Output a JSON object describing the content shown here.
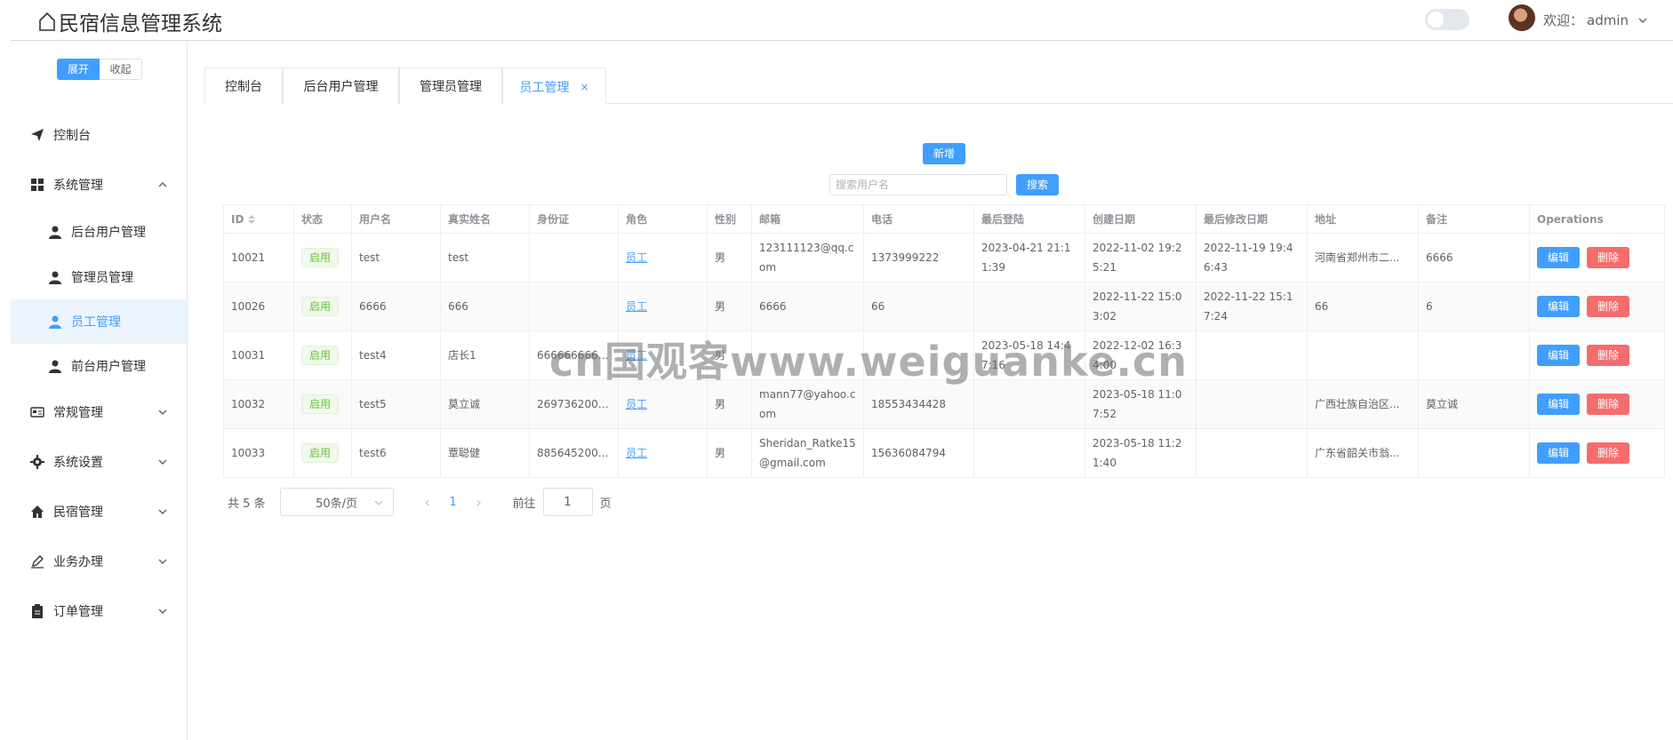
{
  "header": {
    "title": "民宿信息管理系统",
    "welcome_prefix": "欢迎：",
    "username": "admin"
  },
  "sidebar": {
    "expand_label": "展开",
    "collapse_label": "收起",
    "items": [
      {
        "label": "控制台",
        "icon": "paper-plane-icon"
      },
      {
        "label": "系统管理",
        "icon": "grid-icon",
        "expanded": true
      },
      {
        "label": "后台用户管理",
        "icon": "user-icon"
      },
      {
        "label": "管理员管理",
        "icon": "user-icon"
      },
      {
        "label": "员工管理",
        "icon": "user-icon",
        "active": true
      },
      {
        "label": "前台用户管理",
        "icon": "user-icon"
      },
      {
        "label": "常规管理",
        "icon": "id-card-icon"
      },
      {
        "label": "系统设置",
        "icon": "gear-icon"
      },
      {
        "label": "民宿管理",
        "icon": "house-icon"
      },
      {
        "label": "业务办理",
        "icon": "edit-pen-icon"
      },
      {
        "label": "订单管理",
        "icon": "clipboard-icon"
      }
    ]
  },
  "tabs": [
    {
      "label": "控制台"
    },
    {
      "label": "后台用户管理"
    },
    {
      "label": "管理员管理"
    },
    {
      "label": "员工管理",
      "active": true,
      "close": "×"
    }
  ],
  "toolbar": {
    "add_label": "新增",
    "search_placeholder": "搜索用户名",
    "search_label": "搜索"
  },
  "table": {
    "columns": [
      "ID",
      "状态",
      "用户名",
      "真实姓名",
      "身份证",
      "角色",
      "性别",
      "邮箱",
      "电话",
      "最后登陆",
      "创建日期",
      "最后修改日期",
      "地址",
      "备注",
      "Operations"
    ],
    "rows": [
      {
        "id": "10021",
        "status": "启用",
        "username": "test",
        "realname": "test",
        "idcard": "",
        "role": "员工",
        "gender": "男",
        "email": "123111123@qq.com",
        "phone": "1373999222",
        "last_login": "2023-04-21 21:11:39",
        "created": "2022-11-02 19:25:21",
        "modified": "2022-11-19 19:46:43",
        "address": "河南省郑州市二...",
        "remark": "6666"
      },
      {
        "id": "10026",
        "status": "启用",
        "username": "6666",
        "realname": "666",
        "idcard": "",
        "role": "员工",
        "gender": "男",
        "email": "6666",
        "phone": "66",
        "last_login": "",
        "created": "2022-11-22 15:03:02",
        "modified": "2022-11-22 15:17:24",
        "address": "66",
        "remark": "6"
      },
      {
        "id": "10031",
        "status": "启用",
        "username": "test4",
        "realname": "店长1",
        "idcard": "6666666666...",
        "role": "员工",
        "gender": "男",
        "email": "",
        "phone": "",
        "last_login": "2023-05-18 14:47:16",
        "created": "2022-12-02 16:34:00",
        "modified": "",
        "address": "",
        "remark": ""
      },
      {
        "id": "10032",
        "status": "启用",
        "username": "test5",
        "realname": "莫立诚",
        "idcard": "2697362001...",
        "role": "员工",
        "gender": "男",
        "email": "mann77@yahoo.com",
        "phone": "18553434428",
        "last_login": "",
        "created": "2023-05-18 11:07:52",
        "modified": "",
        "address": "广西壮族自治区...",
        "remark": "莫立诚"
      },
      {
        "id": "10033",
        "status": "启用",
        "username": "test6",
        "realname": "覃聪健",
        "idcard": "8856452009...",
        "role": "员工",
        "gender": "男",
        "email": "Sheridan_Ratke15@gmail.com",
        "phone": "15636084794",
        "last_login": "",
        "created": "2023-05-18 11:21:40",
        "modified": "",
        "address": "广东省韶关市翁...",
        "remark": ""
      }
    ],
    "edit_label": "编辑",
    "delete_label": "删除"
  },
  "pagination": {
    "total_text": "共 5 条",
    "page_size": "50条/页",
    "current_page": "1",
    "goto_prefix": "前往",
    "goto_value": "1",
    "goto_suffix": "页"
  },
  "watermark": "cn国观客www.weiguanke.cn",
  "colors": {
    "primary": "#409eff",
    "danger": "#f56c6c",
    "success": "#67c23a"
  }
}
